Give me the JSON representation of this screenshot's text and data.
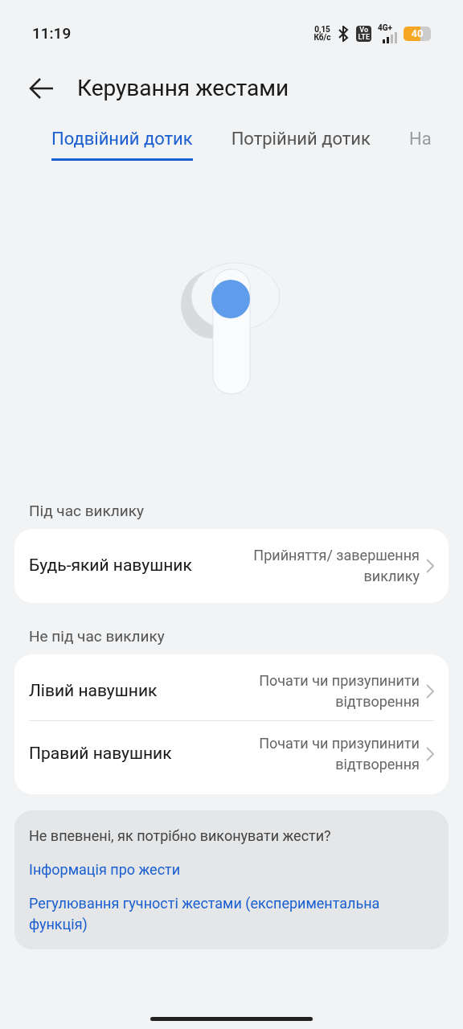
{
  "status_bar": {
    "time": "11:19",
    "speed_value": "0,15",
    "speed_unit": "Кб/с",
    "volte_top": "Vo",
    "volte_bottom": "LTE",
    "network": "4G+",
    "battery": "40"
  },
  "header": {
    "title": "Керування жестами"
  },
  "tabs": [
    {
      "label": "Подвійний дотик",
      "selected": true
    },
    {
      "label": "Потрійний дотик",
      "selected": false
    },
    {
      "label": "На",
      "selected": false
    }
  ],
  "sections": [
    {
      "title": "Під час виклику",
      "items": [
        {
          "label": "Будь-який навушник",
          "value": "Прийняття/ завершення виклику"
        }
      ]
    },
    {
      "title": "Не під час виклику",
      "items": [
        {
          "label": "Лівий навушник",
          "value": "Почати чи призупинити відтворення"
        },
        {
          "label": "Правий навушник",
          "value": "Почати чи призупинити відтворення"
        }
      ]
    }
  ],
  "help": {
    "question": "Не впевнені, як потрібно виконувати жести?",
    "links": [
      "Інформація про жести",
      "Регулювання гучності жестами (експериментальна функція)"
    ]
  }
}
